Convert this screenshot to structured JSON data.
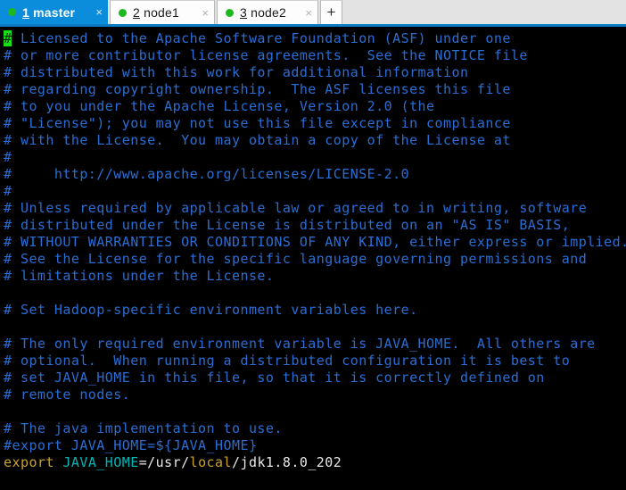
{
  "window": {
    "title": "1 master",
    "accent_color": "#0b8ddb",
    "tabbar_bg": "#e3e3e3",
    "tabbar_border": "#0b7ac4"
  },
  "tabs": {
    "items": [
      {
        "number": "1",
        "name": " master",
        "active": true,
        "dot_color": "#1db81d",
        "close_label": "×"
      },
      {
        "number": "2",
        "name": " node1",
        "active": false,
        "dot_color": "#1db81d",
        "close_label": "×"
      },
      {
        "number": "3",
        "name": " node2",
        "active": false,
        "dot_color": "#1db81d",
        "close_label": "×"
      }
    ],
    "new_tab_label": "+"
  },
  "terminal": {
    "background": "#000000",
    "comment_color": "#2a6ed4",
    "keyword_color": "#c9a227",
    "variable_color": "#00b7b7",
    "plain_color": "#e8e8e8",
    "cursor_color": "#16e016",
    "cursor_char": "#",
    "lines": [
      {
        "id": 1,
        "segments": [
          {
            "text": "#",
            "style": "cursor"
          },
          {
            "text": " Licensed to the Apache Software Foundation (ASF) under one",
            "style": "comment"
          }
        ]
      },
      {
        "id": 2,
        "segments": [
          {
            "text": "# or more contributor license agreements.  See the NOTICE file",
            "style": "comment"
          }
        ]
      },
      {
        "id": 3,
        "segments": [
          {
            "text": "# distributed with this work for additional information",
            "style": "comment"
          }
        ]
      },
      {
        "id": 4,
        "segments": [
          {
            "text": "# regarding copyright ownership.  The ASF licenses this file",
            "style": "comment"
          }
        ]
      },
      {
        "id": 5,
        "segments": [
          {
            "text": "# to you under the Apache License, Version 2.0 (the",
            "style": "comment"
          }
        ]
      },
      {
        "id": 6,
        "segments": [
          {
            "text": "# \"License\"); you may not use this file except in compliance",
            "style": "comment"
          }
        ]
      },
      {
        "id": 7,
        "segments": [
          {
            "text": "# with the License.  You may obtain a copy of the License at",
            "style": "comment"
          }
        ]
      },
      {
        "id": 8,
        "segments": [
          {
            "text": "#",
            "style": "comment"
          }
        ]
      },
      {
        "id": 9,
        "segments": [
          {
            "text": "#     http://www.apache.org/licenses/LICENSE-2.0",
            "style": "comment"
          }
        ]
      },
      {
        "id": 10,
        "segments": [
          {
            "text": "#",
            "style": "comment"
          }
        ]
      },
      {
        "id": 11,
        "segments": [
          {
            "text": "# Unless required by applicable law or agreed to in writing, software",
            "style": "comment"
          }
        ]
      },
      {
        "id": 12,
        "segments": [
          {
            "text": "# distributed under the License is distributed on an \"AS IS\" BASIS,",
            "style": "comment"
          }
        ]
      },
      {
        "id": 13,
        "segments": [
          {
            "text": "# WITHOUT WARRANTIES OR CONDITIONS OF ANY KIND, either express or implied.",
            "style": "comment"
          }
        ]
      },
      {
        "id": 14,
        "segments": [
          {
            "text": "# See the License for the specific language governing permissions and",
            "style": "comment"
          }
        ]
      },
      {
        "id": 15,
        "segments": [
          {
            "text": "# limitations under the License.",
            "style": "comment"
          }
        ]
      },
      {
        "id": 16,
        "segments": [
          {
            "text": "",
            "style": "plain"
          }
        ]
      },
      {
        "id": 17,
        "segments": [
          {
            "text": "# Set Hadoop-specific environment variables here.",
            "style": "comment"
          }
        ]
      },
      {
        "id": 18,
        "segments": [
          {
            "text": "",
            "style": "plain"
          }
        ]
      },
      {
        "id": 19,
        "segments": [
          {
            "text": "# The only required environment variable is JAVA_HOME.  All others are",
            "style": "comment"
          }
        ]
      },
      {
        "id": 20,
        "segments": [
          {
            "text": "# optional.  When running a distributed configuration it is best to",
            "style": "comment"
          }
        ]
      },
      {
        "id": 21,
        "segments": [
          {
            "text": "# set JAVA_HOME in this file, so that it is correctly defined on",
            "style": "comment"
          }
        ]
      },
      {
        "id": 22,
        "segments": [
          {
            "text": "# remote nodes.",
            "style": "comment"
          }
        ]
      },
      {
        "id": 23,
        "segments": [
          {
            "text": "",
            "style": "plain"
          }
        ]
      },
      {
        "id": 24,
        "segments": [
          {
            "text": "# The java implementation to use.",
            "style": "comment"
          }
        ]
      },
      {
        "id": 25,
        "segments": [
          {
            "text": "#export JAVA_HOME=${JAVA_HOME}",
            "style": "comment"
          }
        ]
      },
      {
        "id": 26,
        "segments": [
          {
            "text": "export",
            "style": "keyword"
          },
          {
            "text": " ",
            "style": "plain"
          },
          {
            "text": "JAVA_HOME",
            "style": "var"
          },
          {
            "text": "=/usr/",
            "style": "plain"
          },
          {
            "text": "local",
            "style": "path"
          },
          {
            "text": "/jdk1.8.0_202",
            "style": "plain"
          }
        ]
      }
    ]
  }
}
